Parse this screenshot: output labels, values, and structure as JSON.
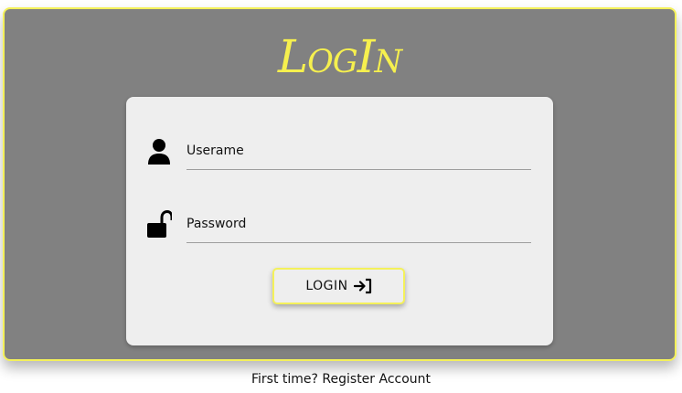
{
  "title": "LogIn",
  "form": {
    "username_placeholder": "Userame",
    "password_placeholder": "Password",
    "login_label": "LOGIN"
  },
  "footer": {
    "prompt": "First time?",
    "link": "Register Account"
  },
  "icons": {
    "user": "user-icon",
    "lock": "unlock-icon",
    "login": "sign-in-icon"
  },
  "colors": {
    "accent": "#f4f15a",
    "panel": "#818181",
    "card": "#eeeeee"
  }
}
